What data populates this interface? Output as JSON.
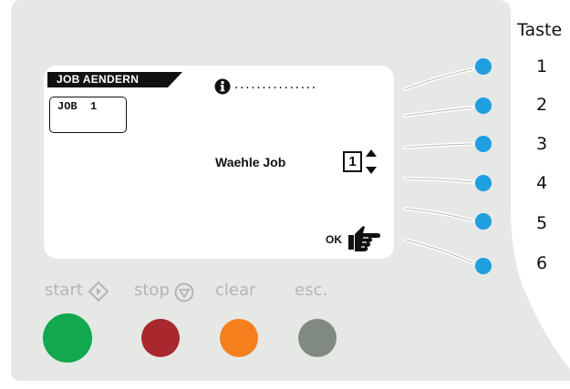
{
  "display": {
    "tab_title": "JOB AENDERN",
    "job_box": "JOB  1",
    "info_dots": "...............",
    "select_label": "Waehle Job",
    "job_number": "1",
    "ok_label": "OK"
  },
  "side_keys": {
    "title": "Taste",
    "keys": [
      "1",
      "2",
      "3",
      "4",
      "5",
      "6"
    ]
  },
  "controls": {
    "start": "start",
    "stop": "stop",
    "clear": "clear",
    "esc": "esc."
  },
  "colors": {
    "panel": "#e6e8e6",
    "key_led": "#1f9ee0",
    "start": "#11a84e",
    "stop": "#a8282e",
    "clear": "#f57f1d",
    "esc": "#808a80",
    "label_gray": "#b3b5b3"
  },
  "icons": {
    "info": "info-icon",
    "up": "arrow-up-icon",
    "down": "arrow-down-icon",
    "ok": "pointing-hand-icon",
    "start": "start-diamond-icon",
    "stop": "stop-triangle-icon"
  }
}
